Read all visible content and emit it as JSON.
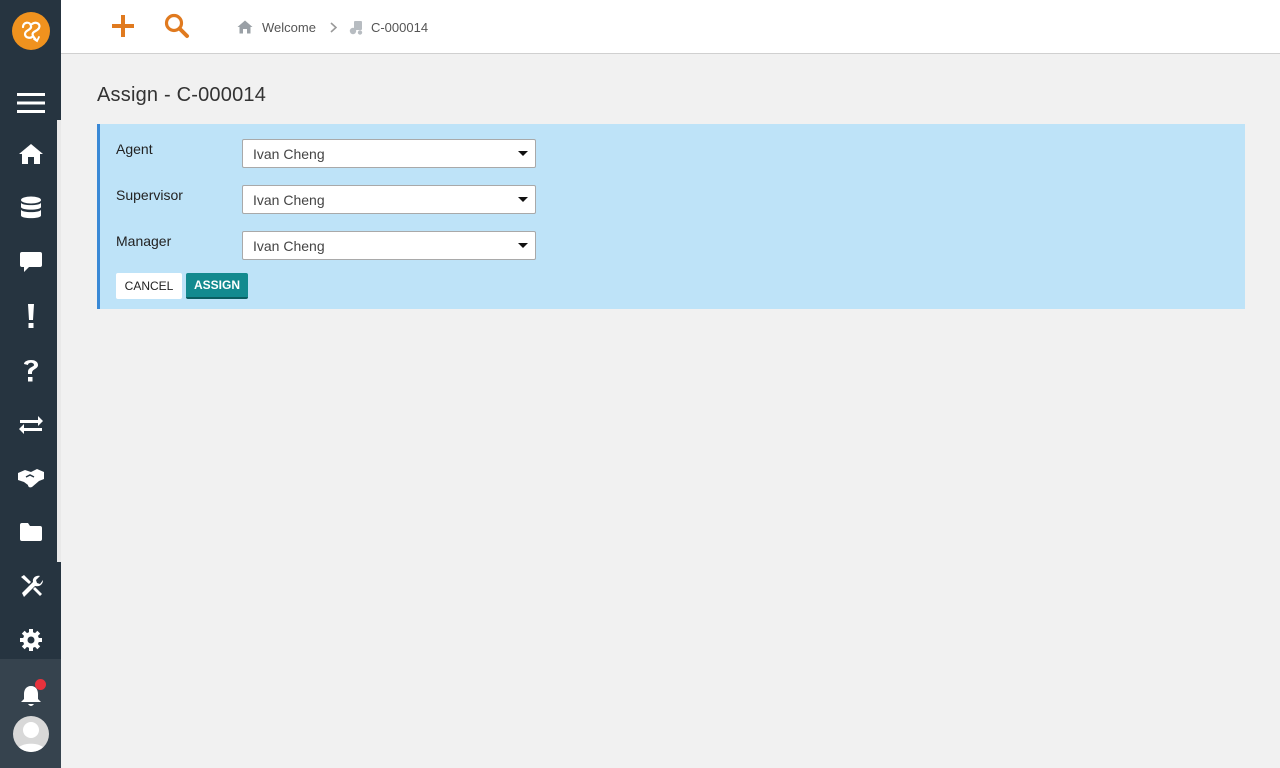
{
  "sidebar": {
    "items": [
      {
        "icon": "menu-icon"
      },
      {
        "icon": "home-icon"
      },
      {
        "icon": "database-icon"
      },
      {
        "icon": "comment-icon"
      },
      {
        "icon": "exclamation-icon"
      },
      {
        "icon": "question-icon"
      },
      {
        "icon": "exchange-icon"
      },
      {
        "icon": "handshake-icon"
      },
      {
        "icon": "folder-icon"
      },
      {
        "icon": "tools-icon"
      },
      {
        "icon": "settings-icon"
      }
    ],
    "notification_icon": "bell-icon",
    "notification_dot_color": "#e8323c"
  },
  "toolbar": {
    "add_icon": "plus-icon",
    "search_icon": "search-icon",
    "accent_color": "#e07a1f"
  },
  "breadcrumb": {
    "items": [
      {
        "label": "Welcome",
        "icon": "home-icon"
      },
      {
        "label": "C-000014",
        "icon": "case-icon"
      }
    ]
  },
  "page": {
    "title": "Assign - C-000014"
  },
  "form": {
    "fields": [
      {
        "label": "Agent",
        "value": "Ivan Cheng"
      },
      {
        "label": "Supervisor",
        "value": "Ivan Cheng"
      },
      {
        "label": "Manager",
        "value": "Ivan Cheng"
      }
    ],
    "cancel_label": "CANCEL",
    "assign_label": "ASSIGN",
    "panel_color": "#bee3f8",
    "assign_color": "#138a8f"
  }
}
